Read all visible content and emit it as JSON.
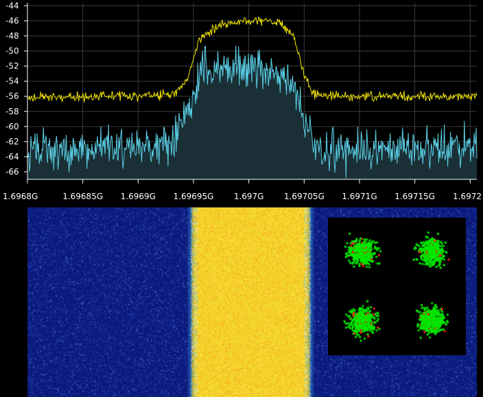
{
  "chart_data": {
    "type": "line",
    "title": "",
    "xlabel": "",
    "ylabel": "",
    "x_unit": "Hz",
    "xlim": [
      1696800000,
      1697206000
    ],
    "ylim": [
      -67,
      -43.6
    ],
    "x_ticks": [
      {
        "value": 1696800000,
        "label": "1.6968G"
      },
      {
        "value": 1696850000,
        "label": "1.69685G"
      },
      {
        "value": 1696900000,
        "label": "1.6969G"
      },
      {
        "value": 1696950000,
        "label": "1.69695G"
      },
      {
        "value": 1697000000,
        "label": "1.697G"
      },
      {
        "value": 1697050000,
        "label": "1.69705G"
      },
      {
        "value": 1697100000,
        "label": "1.6971G"
      },
      {
        "value": 1697150000,
        "label": "1.69715G"
      },
      {
        "value": 1697200000,
        "label": "1.6972"
      }
    ],
    "y_ticks": [
      {
        "value": -44,
        "label": "-44"
      },
      {
        "value": -46,
        "label": "-46"
      },
      {
        "value": -48,
        "label": "-48"
      },
      {
        "value": -50,
        "label": "-50"
      },
      {
        "value": -52,
        "label": "-52"
      },
      {
        "value": -54,
        "label": "-54"
      },
      {
        "value": -56,
        "label": "-56"
      },
      {
        "value": -58,
        "label": "-58"
      },
      {
        "value": -60,
        "label": "-60"
      },
      {
        "value": -62,
        "label": "-62"
      },
      {
        "value": -64,
        "label": "-64"
      },
      {
        "value": -66,
        "label": "-66"
      }
    ],
    "grid": true,
    "series": [
      {
        "role": "peak-hold",
        "color": "#f2e600",
        "x": [
          1696800000,
          1696860000,
          1696920000,
          1696935000,
          1696945000,
          1696955000,
          1696970000,
          1696990000,
          1697010000,
          1697030000,
          1697040000,
          1697048000,
          1697055000,
          1697065000,
          1697120000,
          1697204000
        ],
        "values": [
          -56.2,
          -56.0,
          -55.8,
          -55.4,
          -53.5,
          -48.5,
          -46.8,
          -46.1,
          -45.9,
          -46.5,
          -48.0,
          -52.0,
          -55.0,
          -56.0,
          -56.0,
          -56.0
        ]
      },
      {
        "role": "live",
        "color": "#5cd3ea",
        "fill": "#1a3036",
        "x": [
          1696800000,
          1696860000,
          1696920000,
          1696935000,
          1696945000,
          1696955000,
          1696970000,
          1696990000,
          1697010000,
          1697030000,
          1697040000,
          1697048000,
          1697055000,
          1697065000,
          1697120000,
          1697204000
        ],
        "values": [
          -63.0,
          -63.0,
          -62.5,
          -61.5,
          -58.0,
          -53.5,
          -52.5,
          -52.0,
          -52.5,
          -53.0,
          -55.0,
          -58.5,
          -61.5,
          -63.0,
          -63.0,
          -63.0
        ]
      }
    ]
  },
  "waterfall": {
    "background_color": "#0b1a7a",
    "noise_color": "#2a47c4",
    "band_color": "#f2d32a",
    "band_edge_color": "#3aa0d8",
    "band_start_hz": 1696951000,
    "band_end_hz": 1697052000
  },
  "constellation": {
    "background_color": "#000000",
    "point_color": "#00e600",
    "error_color": "#ff1a1a",
    "clusters": [
      {
        "i": -1,
        "q": 1
      },
      {
        "i": 1,
        "q": 1
      },
      {
        "i": -1,
        "q": -1
      },
      {
        "i": 1,
        "q": -1
      }
    ]
  }
}
